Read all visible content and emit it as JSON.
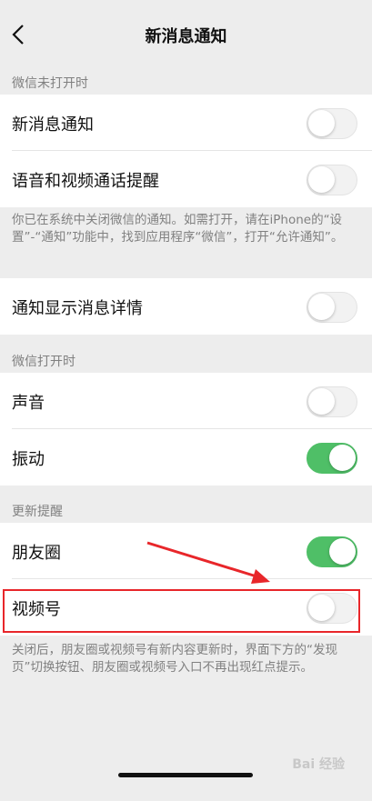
{
  "navbar": {
    "title": "新消息通知",
    "back_icon": "chevron-left-icon"
  },
  "sections": {
    "closed_header": "微信未打开时",
    "open_header": "微信打开时",
    "update_header": "更新提醒"
  },
  "cells": {
    "new_msg": {
      "label": "新消息通知",
      "on": false
    },
    "call_remind": {
      "label": "语音和视频通话提醒",
      "on": false
    },
    "show_detail": {
      "label": "通知显示消息详情",
      "on": false
    },
    "sound": {
      "label": "声音",
      "on": false
    },
    "vibrate": {
      "label": "振动",
      "on": true
    },
    "moments": {
      "label": "朋友圈",
      "on": true
    },
    "channels": {
      "label": "视频号",
      "on": false
    }
  },
  "notes": {
    "system_note": "你已在系统中关闭微信的通知。如需打开，请在iPhone的“设置”-“通知”功能中，找到应用程序“微信”，打开“允许通知”。",
    "update_note": "关闭后，朋友圈或视频号有新内容更新时，界面下方的“发现页”切换按钮、朋友圈或视频号入口不再出现红点提示。"
  },
  "colors": {
    "toggle_on": "#4fbf67",
    "annotation_red": "#e8262a",
    "background": "#ededed"
  },
  "watermark": "Bai 经验"
}
